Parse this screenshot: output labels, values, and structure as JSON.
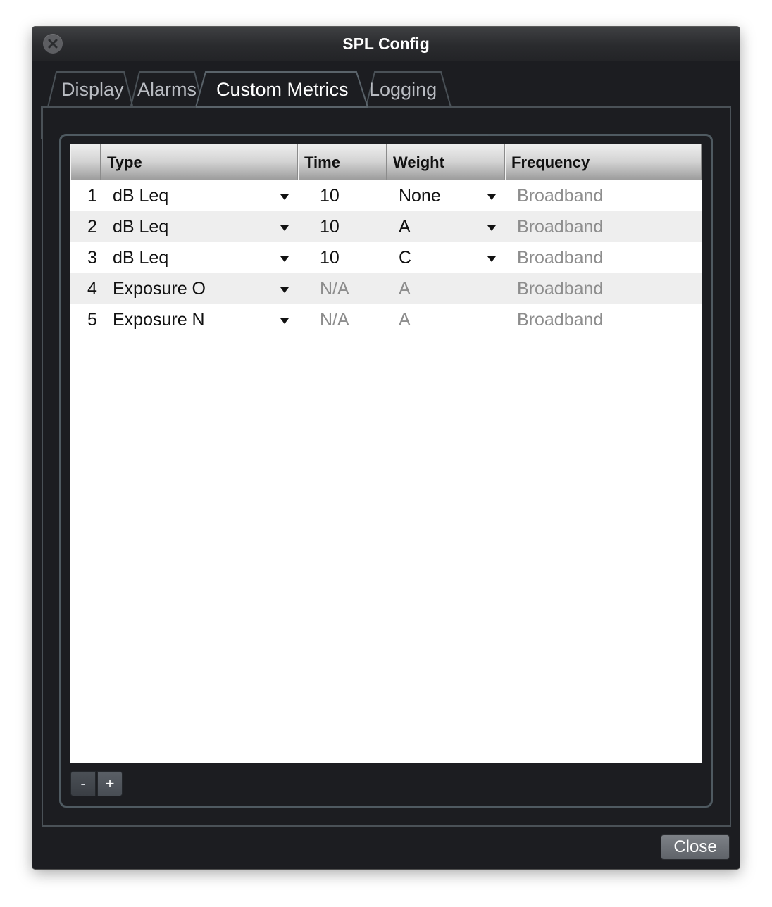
{
  "window": {
    "title": "SPL Config"
  },
  "tabs": [
    {
      "label": "Display",
      "active": false
    },
    {
      "label": "Alarms",
      "active": false
    },
    {
      "label": "Custom Metrics",
      "active": true
    },
    {
      "label": "Logging",
      "active": false
    }
  ],
  "table": {
    "columns": [
      "Type",
      "Time",
      "Weight",
      "Frequency"
    ],
    "rows": [
      {
        "index": "1",
        "type": "dB Leq",
        "time": "10",
        "weight": "None",
        "frequency": "Broadband"
      },
      {
        "index": "2",
        "type": "dB Leq",
        "time": "10",
        "weight": "A",
        "frequency": "Broadband"
      },
      {
        "index": "3",
        "type": "dB Leq",
        "time": "10",
        "weight": "C",
        "frequency": "Broadband"
      },
      {
        "index": "4",
        "type": "Exposure O",
        "time": "N/A",
        "weight": "A",
        "frequency": "Broadband"
      },
      {
        "index": "5",
        "type": "Exposure N",
        "time": "N/A",
        "weight": "A",
        "frequency": "Broadband"
      }
    ]
  },
  "buttons": {
    "remove_label": "-",
    "add_label": "+",
    "close_label": "Close"
  },
  "icons": {
    "window_close": "close-x-icon",
    "dropdown": "dropdown-arrow-icon"
  },
  "colors": {
    "window_bg": "#1c1d21",
    "panel_border": "#4f5a61",
    "dim_text": "#8d8d8d",
    "alt_row": "#eeeeee"
  }
}
